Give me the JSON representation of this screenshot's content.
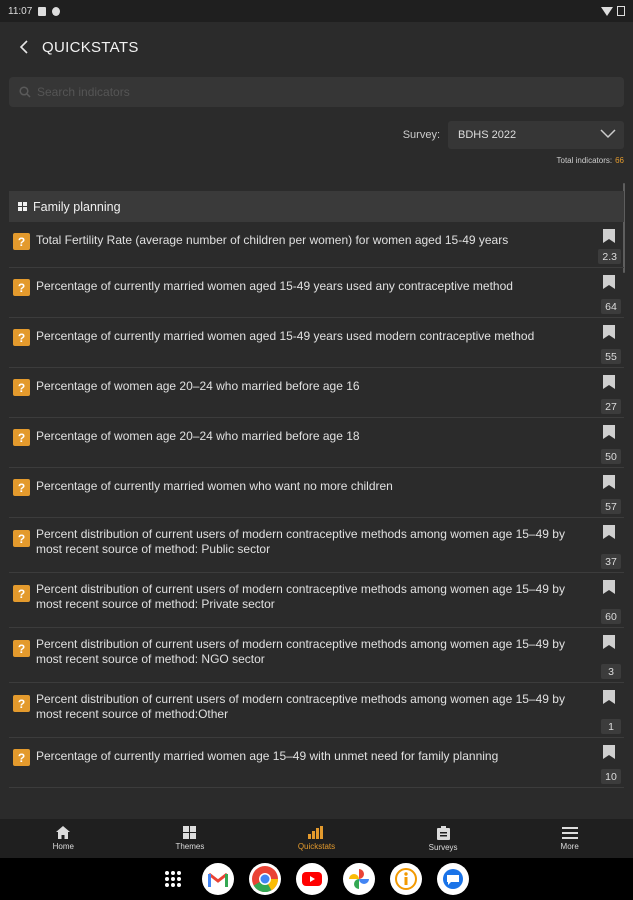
{
  "status_bar": {
    "time": "11:07"
  },
  "header": {
    "title": "QUICKSTATS"
  },
  "search": {
    "placeholder": "Search indicators"
  },
  "survey": {
    "label": "Survey:",
    "selected": "BDHS 2022"
  },
  "totals": {
    "label": "Total indicators:",
    "value": "66"
  },
  "section": {
    "title": "Family planning"
  },
  "items": [
    {
      "text": "Total Fertility Rate (average number of children per women) for women aged 15-49 years",
      "value": "2.3"
    },
    {
      "text": "Percentage of currently married women aged 15-49 years used any contraceptive method",
      "value": "64"
    },
    {
      "text": "Percentage of currently married women aged 15-49 years used modern contraceptive method",
      "value": "55"
    },
    {
      "text": "Percentage of women age 20–24 who married before age 16",
      "value": "27"
    },
    {
      "text": "Percentage of women age 20–24 who married before age 18",
      "value": "50"
    },
    {
      "text": "Percentage of currently married women who want no more children",
      "value": "57"
    },
    {
      "text": "Percent distribution of current users of modern contraceptive methods among women age 15–49 by most recent source of method: Public sector",
      "value": "37"
    },
    {
      "text": "Percent distribution of current users of modern contraceptive methods among women age 15–49 by most recent source of method: Private sector",
      "value": "60"
    },
    {
      "text": "Percent distribution of current users of modern contraceptive methods among women age 15–49 by most recent source of method: NGO sector",
      "value": "3"
    },
    {
      "text": "Percent distribution of current users of modern contraceptive methods among women age 15–49 by most recent source of method:Other",
      "value": "1"
    },
    {
      "text": "Percentage of currently married women age 15–49 with unmet need for family planning",
      "value": "10"
    }
  ],
  "nav": [
    {
      "label": "Home",
      "icon": "home-icon"
    },
    {
      "label": "Themes",
      "icon": "grid-icon"
    },
    {
      "label": "Quickstats",
      "icon": "bar-chart-icon",
      "active": true
    },
    {
      "label": "Surveys",
      "icon": "clipboard-icon"
    },
    {
      "label": "More",
      "icon": "menu-icon"
    }
  ],
  "dock": [
    "Gmail",
    "Chrome",
    "YouTube",
    "Photos",
    "Info",
    "Messages"
  ],
  "colors": {
    "accent": "#e39a2d",
    "background": "#2b2b2b",
    "surface": "#363636"
  }
}
